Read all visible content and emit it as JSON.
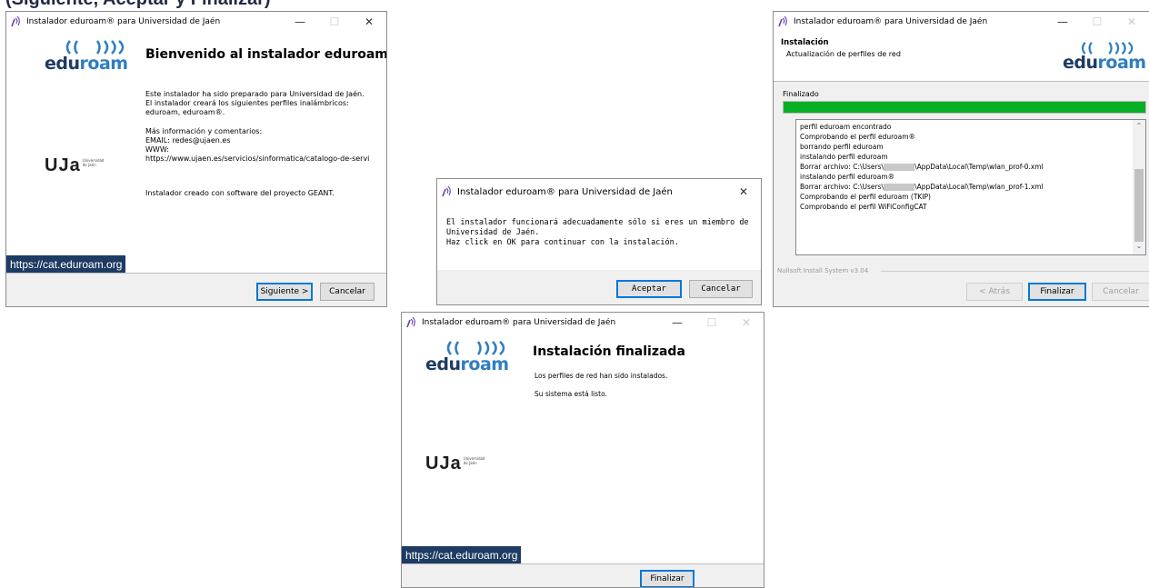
{
  "caption": "(Siguiente, Aceptar y Finalizar)",
  "app_title": "Instalador eduroam® para Universidad de Jaén",
  "logos": {
    "eduroam_edu": "edu",
    "eduroam_roam": "roam",
    "uja": "UJa",
    "uja_small": "Universidad\nde Jaén"
  },
  "cat_link": "https://cat.eduroam.org",
  "welcome": {
    "heading": "Bienvenido al instalador eduroam®",
    "paragraph1": "Este instalador ha sido preparado para Universidad de Jaén.\nEl instalador creará los siguientes perfiles inalámbricos:\neduroam, eduroam®.",
    "paragraph2": "Más información y comentarios:\nEMAIL: redes@ujaen.es\nWWW:\nhttps://www.ujaen.es/servicios/sinformatica/catalogo-de-servi",
    "paragraph3": "Instalador creado con software del proyecto GEANT.",
    "next_button": "Siguiente >",
    "cancel_button": "Cancelar"
  },
  "dialog": {
    "message": "El instalador funcionará adecuadamente sólo si eres un miembro de\nUniversidad de Jaén.\nHaz click en OK para continuar con la instalación.",
    "accept_button": "Aceptar",
    "cancel_button": "Cancelar"
  },
  "install": {
    "section_title": "Instalación",
    "section_subtitle": "Actualización de perfiles de red",
    "status": "Finalizado",
    "progress": 1.0,
    "log": [
      {
        "text": "perfil eduroam encontrado"
      },
      {
        "text": "Comprobando el perfil eduroam®"
      },
      {
        "text": "borrando perfil eduroam"
      },
      {
        "text": "instalando perfil eduroam"
      },
      {
        "prefix": "Borrar archivo: C:\\Users\\",
        "suffix": "\\AppData\\Local\\Temp\\wlan_prof-0.xml"
      },
      {
        "text": "instalando perfil eduroam®"
      },
      {
        "prefix": "Borrar archivo: C:\\Users\\",
        "suffix": "\\AppData\\Local\\Temp\\wlan_prof-1.xml"
      },
      {
        "text": "Comprobando el perfil eduroam (TKIP)"
      },
      {
        "text": "Comprobando el perfil WiFiConfigCAT"
      }
    ],
    "nsis_label": "Nullsoft Install System v3.04",
    "back_button": "< Atrás",
    "finish_button": "Finalizar",
    "cancel_button": "Cancelar"
  },
  "finished": {
    "heading": "Instalación finalizada",
    "line1": "Los perfiles de red han sido instalados.",
    "line2": "Su sistema está listo.",
    "finish_button": "Finalizar"
  },
  "colors": {
    "eduroam_dark": "#1e3b63",
    "eduroam_light": "#2f7ec1",
    "progress_green": "#06b025",
    "default_button_border": "#0078d7"
  },
  "icons": [
    "wifi-install-icon",
    "minimize-icon",
    "maximize-icon",
    "close-icon",
    "eduroam-waves-icon",
    "scroll-up-icon",
    "scroll-down-icon"
  ]
}
